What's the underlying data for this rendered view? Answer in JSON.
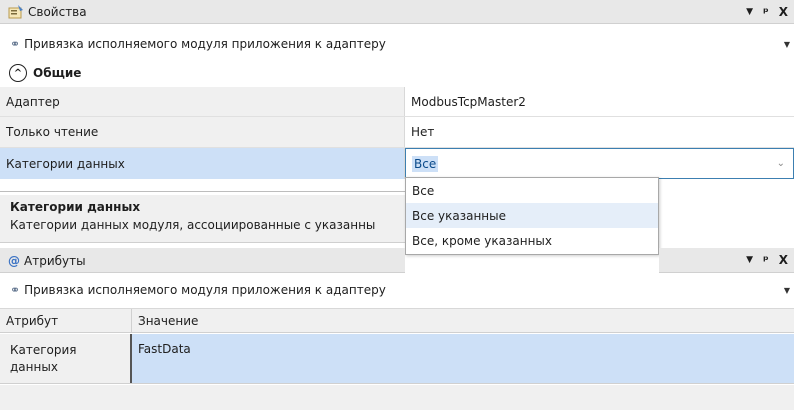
{
  "props_panel": {
    "title": "Свойства",
    "controls": {
      "menu": "▼",
      "pin": "ᵖ",
      "close": "X"
    },
    "context_text": "Привязка исполняемого модуля приложения к адаптеру",
    "section_title": "Общие",
    "rows": [
      {
        "name": "Адаптер",
        "value": "ModbusTcpMaster2"
      },
      {
        "name": "Только чтение",
        "value": "Нет"
      },
      {
        "name": "Категории данных",
        "value": "Все"
      }
    ],
    "description_title": "Категории данных",
    "description_text": "Категории данных модуля, ассоциированные с указанны"
  },
  "dropdown_options": [
    "Все",
    "Все указанные",
    "Все, кроме указанных"
  ],
  "attrs_panel": {
    "title": "Атрибуты",
    "context_text": "Привязка исполняемого модуля приложения к адаптеру",
    "col_attr": "Атрибут",
    "col_value": "Значение",
    "row_attr_line1": "Категория",
    "row_attr_line2": "данных",
    "row_value": "FastData"
  }
}
